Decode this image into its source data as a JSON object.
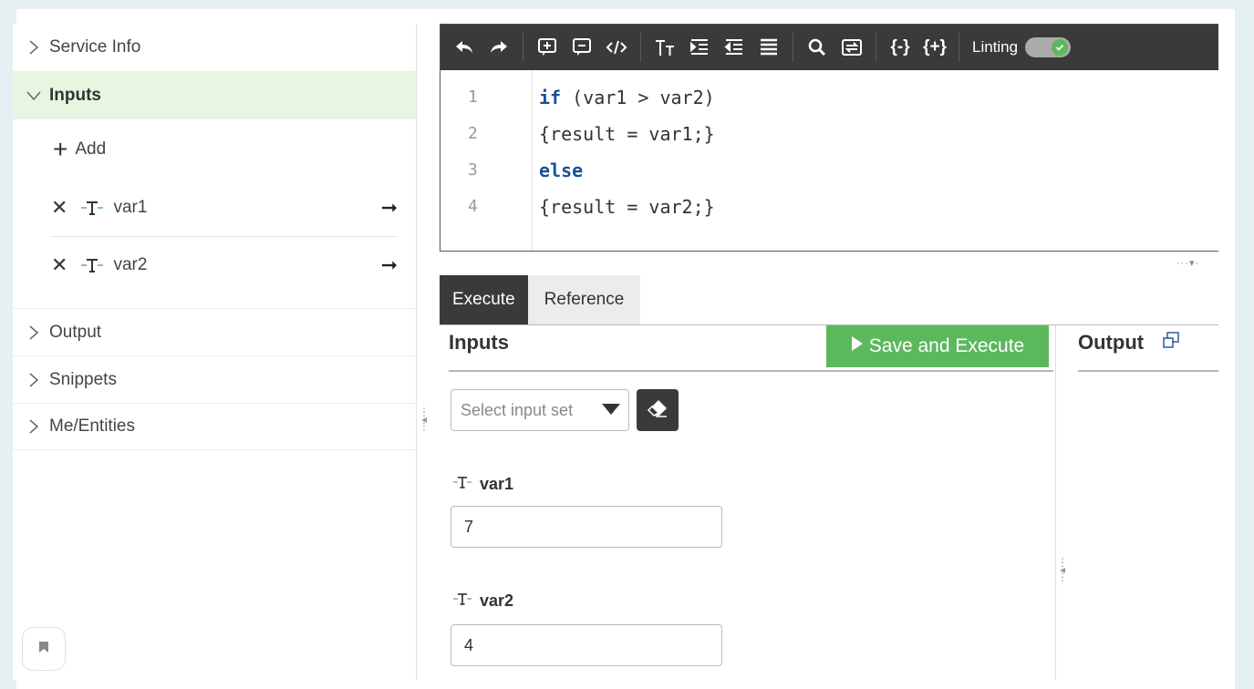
{
  "sidebar": {
    "sections": [
      {
        "label": "Service Info"
      },
      {
        "label": "Inputs"
      },
      {
        "label": "Output"
      },
      {
        "label": "Snippets"
      },
      {
        "label": "Me/Entities"
      }
    ],
    "add_label": "Add",
    "variables": [
      {
        "name": "var1"
      },
      {
        "name": "var2"
      }
    ]
  },
  "toolbar": {
    "icons": [
      "undo-icon",
      "redo-icon",
      "comment-add-icon",
      "comment-remove-icon",
      "code-icon",
      "font-size-icon",
      "indent-icon",
      "outdent-icon",
      "align-justify-icon",
      "search-icon",
      "replace-icon",
      "braces-collapse-icon",
      "braces-expand-icon"
    ],
    "linting_label": "Linting",
    "linting_enabled": true
  },
  "editor": {
    "lines": [
      {
        "num": "1",
        "keyword": "if",
        "rest": " (var1 > var2)"
      },
      {
        "num": "2",
        "keyword": "",
        "rest": "{result = var1;}"
      },
      {
        "num": "3",
        "keyword": "else",
        "rest": ""
      },
      {
        "num": "4",
        "keyword": "",
        "rest": "{result = var2;}"
      }
    ]
  },
  "tabs": [
    {
      "label": "Execute",
      "active": true
    },
    {
      "label": "Reference",
      "active": false
    }
  ],
  "inputs_panel": {
    "title": "Inputs",
    "save_label": "Save and Execute",
    "select_placeholder": "Select input set",
    "fields": [
      {
        "label": "var1",
        "value": "7"
      },
      {
        "label": "var2",
        "value": "4"
      }
    ]
  },
  "output_panel": {
    "title": "Output"
  },
  "colors": {
    "accent_green": "#5cb85c",
    "toolbar_dark": "#3a3a3a",
    "keyword_blue": "#1a4f99",
    "active_section_bg": "#e8f5e0"
  }
}
